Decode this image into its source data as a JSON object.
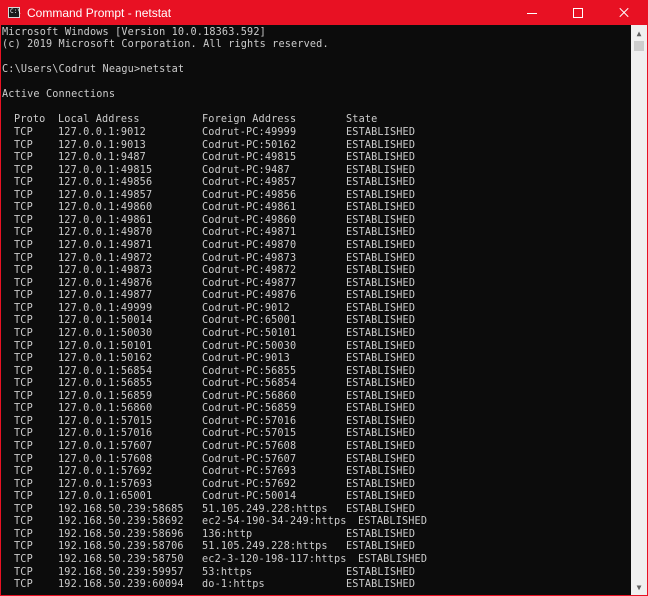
{
  "window": {
    "title": "Command Prompt - netstat"
  },
  "icons": {
    "app": "cmd-icon",
    "minimize": "minimize-icon",
    "maximize": "maximize-icon",
    "close": "close-icon"
  },
  "console": {
    "header_line1": "Microsoft Windows [Version 10.0.18363.592]",
    "header_line2": "(c) 2019 Microsoft Corporation. All rights reserved.",
    "prompt": "C:\\Users\\Codrut Neagu>netstat",
    "section_title": "Active Connections",
    "columns": {
      "proto": "Proto",
      "local": "Local Address",
      "foreign": "Foreign Address",
      "state": "State"
    },
    "rows": [
      {
        "proto": "TCP",
        "local": "127.0.0.1:9012",
        "foreign": "Codrut-PC:49999",
        "state": "ESTABLISHED"
      },
      {
        "proto": "TCP",
        "local": "127.0.0.1:9013",
        "foreign": "Codrut-PC:50162",
        "state": "ESTABLISHED"
      },
      {
        "proto": "TCP",
        "local": "127.0.0.1:9487",
        "foreign": "Codrut-PC:49815",
        "state": "ESTABLISHED"
      },
      {
        "proto": "TCP",
        "local": "127.0.0.1:49815",
        "foreign": "Codrut-PC:9487",
        "state": "ESTABLISHED"
      },
      {
        "proto": "TCP",
        "local": "127.0.0.1:49856",
        "foreign": "Codrut-PC:49857",
        "state": "ESTABLISHED"
      },
      {
        "proto": "TCP",
        "local": "127.0.0.1:49857",
        "foreign": "Codrut-PC:49856",
        "state": "ESTABLISHED"
      },
      {
        "proto": "TCP",
        "local": "127.0.0.1:49860",
        "foreign": "Codrut-PC:49861",
        "state": "ESTABLISHED"
      },
      {
        "proto": "TCP",
        "local": "127.0.0.1:49861",
        "foreign": "Codrut-PC:49860",
        "state": "ESTABLISHED"
      },
      {
        "proto": "TCP",
        "local": "127.0.0.1:49870",
        "foreign": "Codrut-PC:49871",
        "state": "ESTABLISHED"
      },
      {
        "proto": "TCP",
        "local": "127.0.0.1:49871",
        "foreign": "Codrut-PC:49870",
        "state": "ESTABLISHED"
      },
      {
        "proto": "TCP",
        "local": "127.0.0.1:49872",
        "foreign": "Codrut-PC:49873",
        "state": "ESTABLISHED"
      },
      {
        "proto": "TCP",
        "local": "127.0.0.1:49873",
        "foreign": "Codrut-PC:49872",
        "state": "ESTABLISHED"
      },
      {
        "proto": "TCP",
        "local": "127.0.0.1:49876",
        "foreign": "Codrut-PC:49877",
        "state": "ESTABLISHED"
      },
      {
        "proto": "TCP",
        "local": "127.0.0.1:49877",
        "foreign": "Codrut-PC:49876",
        "state": "ESTABLISHED"
      },
      {
        "proto": "TCP",
        "local": "127.0.0.1:49999",
        "foreign": "Codrut-PC:9012",
        "state": "ESTABLISHED"
      },
      {
        "proto": "TCP",
        "local": "127.0.0.1:50014",
        "foreign": "Codrut-PC:65001",
        "state": "ESTABLISHED"
      },
      {
        "proto": "TCP",
        "local": "127.0.0.1:50030",
        "foreign": "Codrut-PC:50101",
        "state": "ESTABLISHED"
      },
      {
        "proto": "TCP",
        "local": "127.0.0.1:50101",
        "foreign": "Codrut-PC:50030",
        "state": "ESTABLISHED"
      },
      {
        "proto": "TCP",
        "local": "127.0.0.1:50162",
        "foreign": "Codrut-PC:9013",
        "state": "ESTABLISHED"
      },
      {
        "proto": "TCP",
        "local": "127.0.0.1:56854",
        "foreign": "Codrut-PC:56855",
        "state": "ESTABLISHED"
      },
      {
        "proto": "TCP",
        "local": "127.0.0.1:56855",
        "foreign": "Codrut-PC:56854",
        "state": "ESTABLISHED"
      },
      {
        "proto": "TCP",
        "local": "127.0.0.1:56859",
        "foreign": "Codrut-PC:56860",
        "state": "ESTABLISHED"
      },
      {
        "proto": "TCP",
        "local": "127.0.0.1:56860",
        "foreign": "Codrut-PC:56859",
        "state": "ESTABLISHED"
      },
      {
        "proto": "TCP",
        "local": "127.0.0.1:57015",
        "foreign": "Codrut-PC:57016",
        "state": "ESTABLISHED"
      },
      {
        "proto": "TCP",
        "local": "127.0.0.1:57016",
        "foreign": "Codrut-PC:57015",
        "state": "ESTABLISHED"
      },
      {
        "proto": "TCP",
        "local": "127.0.0.1:57607",
        "foreign": "Codrut-PC:57608",
        "state": "ESTABLISHED"
      },
      {
        "proto": "TCP",
        "local": "127.0.0.1:57608",
        "foreign": "Codrut-PC:57607",
        "state": "ESTABLISHED"
      },
      {
        "proto": "TCP",
        "local": "127.0.0.1:57692",
        "foreign": "Codrut-PC:57693",
        "state": "ESTABLISHED"
      },
      {
        "proto": "TCP",
        "local": "127.0.0.1:57693",
        "foreign": "Codrut-PC:57692",
        "state": "ESTABLISHED"
      },
      {
        "proto": "TCP",
        "local": "127.0.0.1:65001",
        "foreign": "Codrut-PC:50014",
        "state": "ESTABLISHED"
      },
      {
        "proto": "TCP",
        "local": "192.168.50.239:58685",
        "foreign": "51.105.249.228:https",
        "state": "ESTABLISHED"
      },
      {
        "proto": "TCP",
        "local": "192.168.50.239:58692",
        "foreign": "ec2-54-190-34-249:https",
        "state": "ESTABLISHED"
      },
      {
        "proto": "TCP",
        "local": "192.168.50.239:58696",
        "foreign": "136:http",
        "state": "ESTABLISHED"
      },
      {
        "proto": "TCP",
        "local": "192.168.50.239:58706",
        "foreign": "51.105.249.228:https",
        "state": "ESTABLISHED"
      },
      {
        "proto": "TCP",
        "local": "192.168.50.239:58750",
        "foreign": "ec2-3-120-198-117:https",
        "state": "ESTABLISHED"
      },
      {
        "proto": "TCP",
        "local": "192.168.50.239:59957",
        "foreign": "53:https",
        "state": "ESTABLISHED"
      },
      {
        "proto": "TCP",
        "local": "192.168.50.239:60094",
        "foreign": "do-1:https",
        "state": "ESTABLISHED"
      }
    ]
  },
  "colors": {
    "titlebar": "#e81123",
    "console_bg": "#0c0c0c",
    "console_text": "#cccccc",
    "scrollbar": "#f0f0f0"
  }
}
